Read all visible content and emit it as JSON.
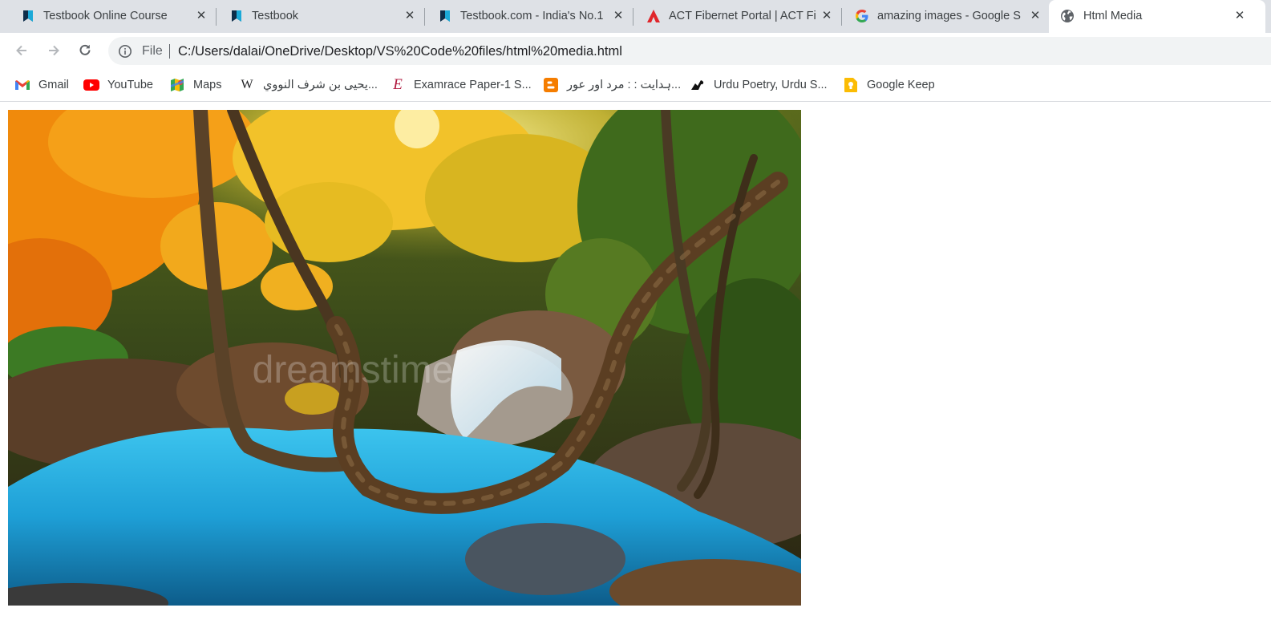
{
  "tabs": [
    {
      "title": "Testbook Online Course",
      "icon": "testbook-icon"
    },
    {
      "title": "Testbook",
      "icon": "testbook-icon"
    },
    {
      "title": "Testbook.com - India's No.1",
      "icon": "testbook-icon"
    },
    {
      "title": "ACT Fibernet Portal | ACT Fi",
      "icon": "act-fibernet-icon"
    },
    {
      "title": "amazing images - Google S",
      "icon": "google-icon"
    },
    {
      "title": "Html Media",
      "icon": "globe-icon"
    }
  ],
  "toolbar": {
    "scheme_label": "File",
    "url": "C:/Users/dalai/OneDrive/Desktop/VS%20Code%20files/html%20media.html"
  },
  "bookmarks": [
    {
      "label": "Gmail",
      "icon": "gmail-icon"
    },
    {
      "label": "YouTube",
      "icon": "youtube-icon"
    },
    {
      "label": "Maps",
      "icon": "maps-icon"
    },
    {
      "label": "يحيى بن شرف النووي...",
      "icon": "wikipedia-icon"
    },
    {
      "label": "Examrace Paper-1 S...",
      "icon": "examrace-icon"
    },
    {
      "label": "ہدایت : : مرد اور عور...",
      "icon": "blogger-icon"
    },
    {
      "label": "Urdu Poetry, Urdu S...",
      "icon": "rekhta-icon"
    },
    {
      "label": "Google Keep",
      "icon": "google-keep-icon"
    }
  ],
  "photo": {
    "watermark": "dreamstime"
  },
  "colors": {
    "tabstrip": "#dee1e6",
    "omnibox": "#f1f3f4",
    "water": "#1e9fd6",
    "foliage_orange": "#f08a0c",
    "foliage_yellow": "#f2c22a"
  }
}
